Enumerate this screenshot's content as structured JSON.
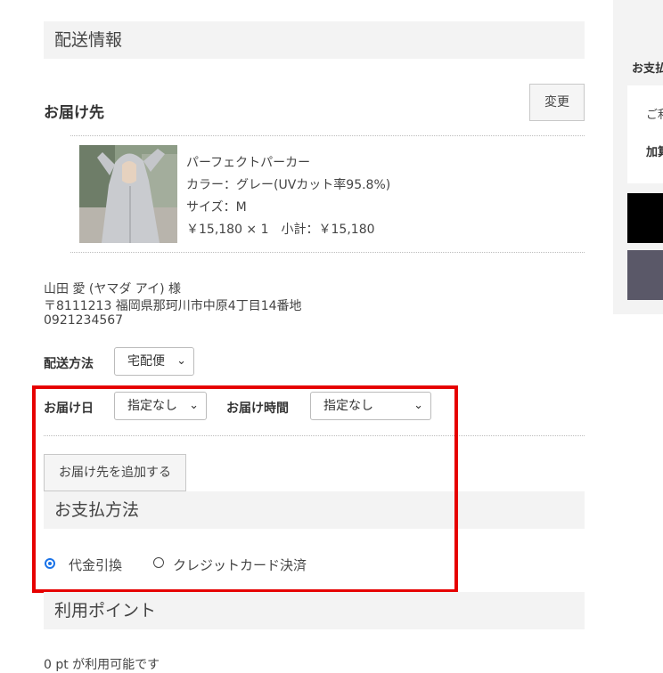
{
  "shipping": {
    "section_title": "配送情報",
    "destination_label": "お届け先",
    "change_button": "変更",
    "product": {
      "name": "パーフェクトパーカー",
      "color": "カラー：グレー(UVカット率95.8%)",
      "size": "サイズ：M",
      "price": "￥15,180 × 1　小計：￥15,180"
    },
    "address": {
      "name": "山田 愛 (ヤマダ アイ) 様",
      "line": "〒8111213 福岡県那珂川市中原4丁目14番地",
      "phone": "0921234567"
    },
    "method_label": "配送方法",
    "method_value": "宅配便",
    "date_label": "お届け日",
    "date_value": "指定なし",
    "time_label": "お届け時間",
    "time_value": "指定なし",
    "add_destination_button": "お届け先を追加する"
  },
  "payment": {
    "section_title": "お支払方法",
    "options": [
      {
        "label": "代金引換",
        "selected": true
      },
      {
        "label": "クレジットカード決済",
        "selected": false
      }
    ]
  },
  "points": {
    "section_title": "利用ポイント",
    "available_text": "0 pt が利用可能です"
  },
  "sidebar": {
    "heading": "お支払",
    "line1": "ご利",
    "line2": "加算"
  },
  "colors": {
    "highlight": "#e60000",
    "radio_selected": "#1a73e8",
    "sidebar_button_dark": "#000000",
    "sidebar_button_gray": "#5a5868"
  }
}
